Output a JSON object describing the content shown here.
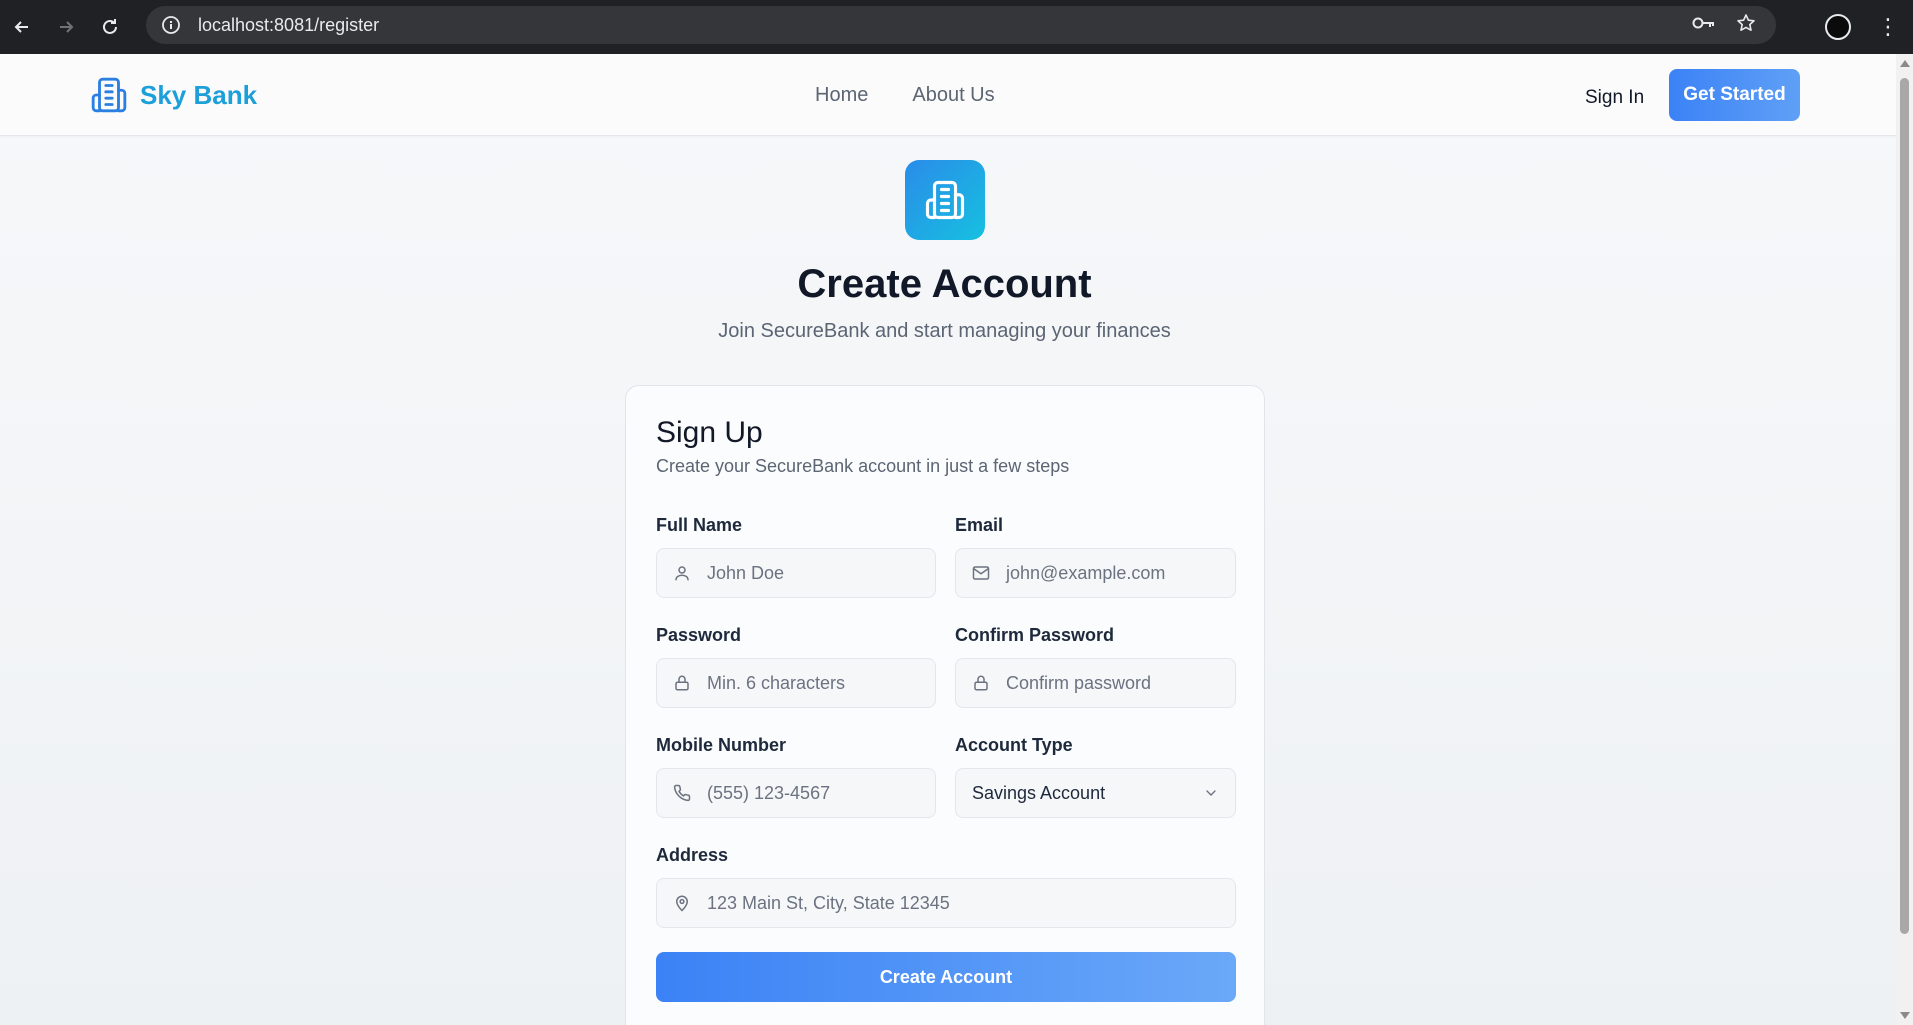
{
  "browser": {
    "url": "localhost:8081/register",
    "back_icon": "arrow-left-icon",
    "forward_icon": "arrow-right-icon",
    "reload_icon": "reload-icon",
    "info_icon": "info-icon",
    "key_icon": "key-icon",
    "star_icon": "star-icon",
    "menu_icon": "kebab-menu-icon"
  },
  "header": {
    "brand": "Sky Bank",
    "nav": [
      "Home",
      "About Us"
    ],
    "sign_in": "Sign In",
    "cta": "Get Started"
  },
  "hero": {
    "title": "Create Account",
    "subtitle": "Join SecureBank and start managing your finances"
  },
  "form": {
    "title": "Sign Up",
    "subtitle": "Create your SecureBank account in just a few steps",
    "full_name": {
      "label": "Full Name",
      "placeholder": "John Doe",
      "icon": "user-icon"
    },
    "email": {
      "label": "Email",
      "placeholder": "john@example.com",
      "icon": "mail-icon"
    },
    "password": {
      "label": "Password",
      "placeholder": "Min. 6 characters",
      "icon": "lock-icon"
    },
    "confirm_password": {
      "label": "Confirm Password",
      "placeholder": "Confirm password",
      "icon": "lock-icon"
    },
    "mobile": {
      "label": "Mobile Number",
      "placeholder": "(555) 123-4567",
      "icon": "phone-icon"
    },
    "account_type": {
      "label": "Account Type",
      "value": "Savings Account",
      "icon": "chevron-down-icon"
    },
    "address": {
      "label": "Address",
      "placeholder": "123 Main St, City, State 12345",
      "icon": "map-pin-icon"
    },
    "submit": "Create Account"
  },
  "colors": {
    "brand": "#1d9fd9",
    "primary": "#3b82f6",
    "chrome_bg": "#202124"
  }
}
